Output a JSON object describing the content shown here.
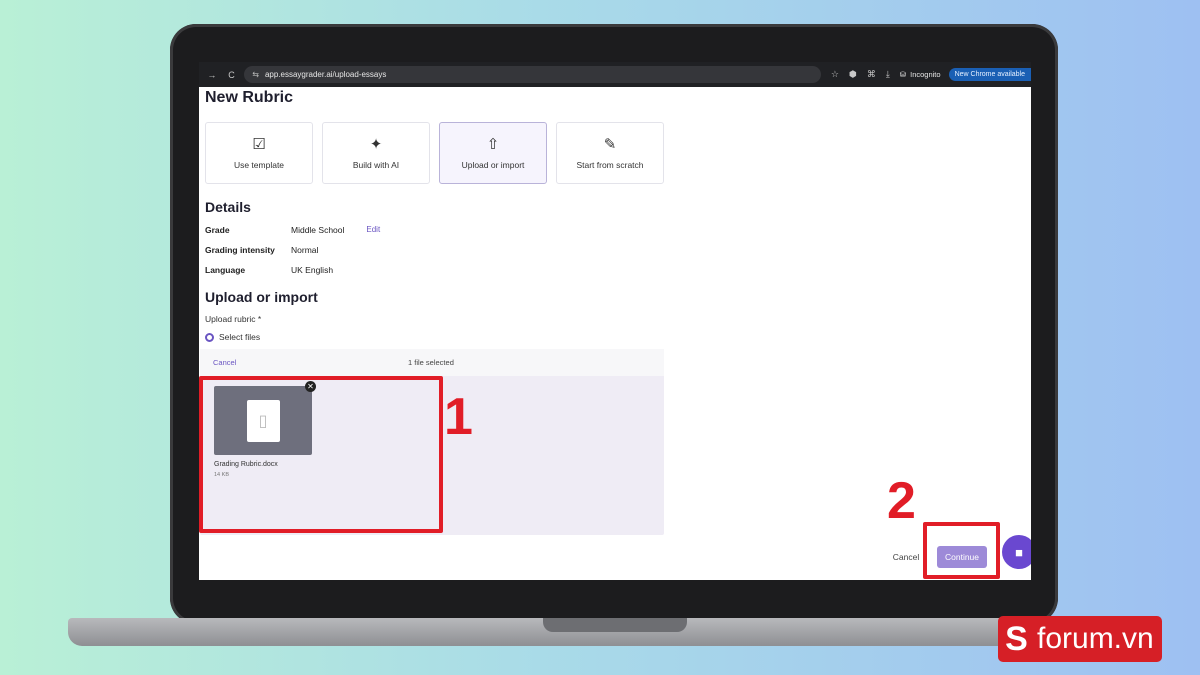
{
  "browser": {
    "back_icon": "→",
    "reload_icon": "C",
    "site_icon": "⇆",
    "url": "app.essaygrader.ai/upload-essays",
    "incognito_label": "Incognito",
    "update_label": "New Chrome available"
  },
  "page": {
    "title": "New Rubric",
    "options": [
      {
        "label": "Use template",
        "icon": "bookmark-check-icon",
        "glyph": "☑"
      },
      {
        "label": "Build with AI",
        "icon": "sparkle-icon",
        "glyph": "✦"
      },
      {
        "label": "Upload or import",
        "icon": "share-upload-icon",
        "glyph": "⇧"
      },
      {
        "label": "Start from scratch",
        "icon": "pencil-icon",
        "glyph": "✎"
      }
    ],
    "details": {
      "title": "Details",
      "rows": [
        {
          "label": "Grade",
          "value": "Middle School"
        },
        {
          "label": "Grading intensity",
          "value": "Normal"
        },
        {
          "label": "Language",
          "value": "UK English"
        }
      ],
      "edit_label": "Edit"
    },
    "upload": {
      "title": "Upload or import",
      "field_label": "Upload rubric *",
      "radio_label": "Select files",
      "cancel_label": "Cancel",
      "files_status": "1 file selected",
      "file": {
        "name": "Grading Rubric.docx",
        "size": "14 KB"
      }
    },
    "footer": {
      "cancel_label": "Cancel",
      "continue_label": "Continue"
    }
  },
  "annotations": {
    "step1": "1",
    "step2": "2",
    "color": "#e11d27"
  },
  "watermark": {
    "badge": "S",
    "text": "forum.vn"
  }
}
